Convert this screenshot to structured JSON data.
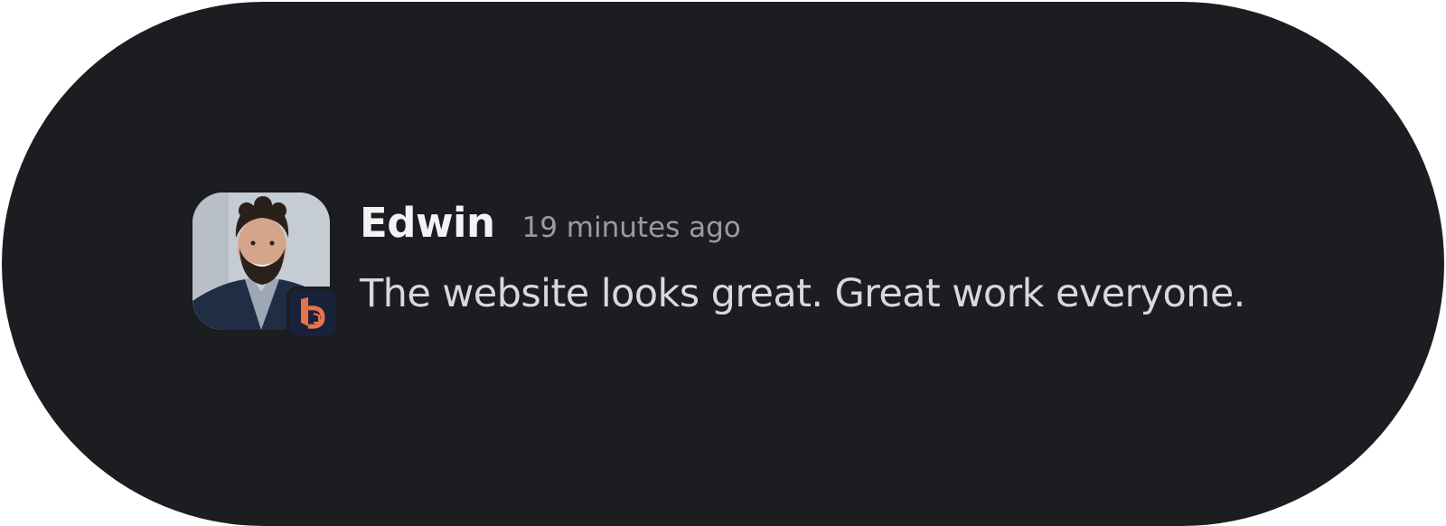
{
  "message": {
    "author": "Edwin",
    "timestamp": "19 minutes ago",
    "text": "The website looks great. Great work everyone."
  },
  "avatar": {
    "icon": "user-photo",
    "badge_icon": "app-logo-b-icon",
    "badge_color": "#e8734a"
  },
  "colors": {
    "background": "#1b1d20",
    "author": "#f2f3f4",
    "timestamp": "#9a9ca0",
    "body": "#d7d9dc"
  }
}
